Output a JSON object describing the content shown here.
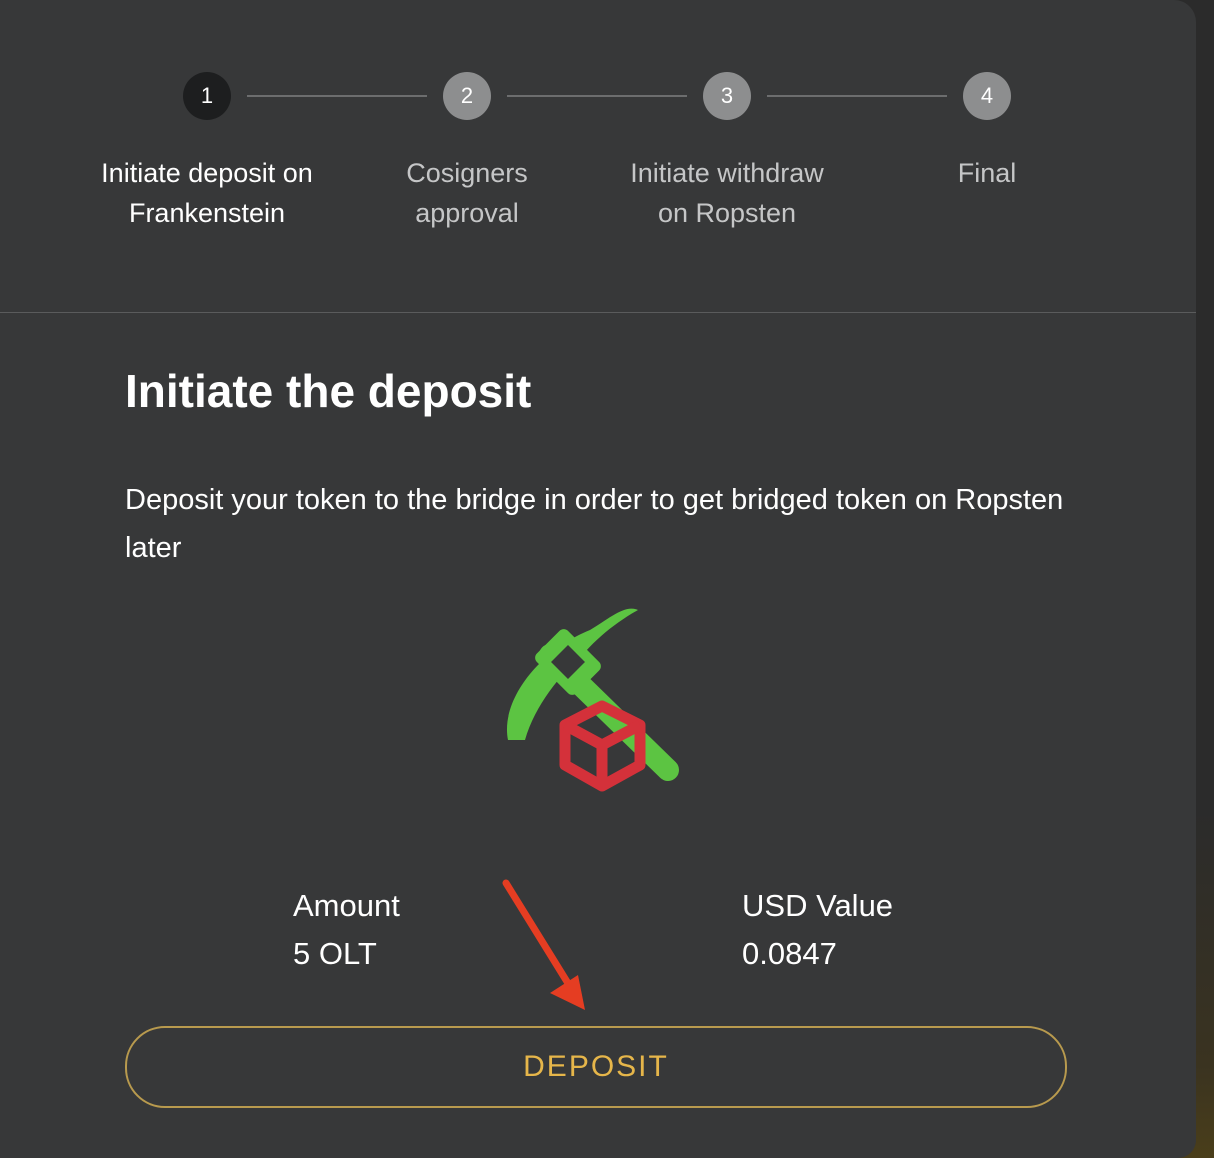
{
  "stepper": {
    "steps": [
      {
        "number": "1",
        "label_line1": "Initiate deposit on",
        "label_line2": "Frankenstein",
        "state": "active"
      },
      {
        "number": "2",
        "label_line1": "Cosigners",
        "label_line2": "approval",
        "state": "inactive"
      },
      {
        "number": "3",
        "label_line1": "Initiate withdraw",
        "label_line2": "on Ropsten",
        "state": "inactive"
      },
      {
        "number": "4",
        "label_line1": "Final",
        "label_line2": "",
        "state": "inactive"
      }
    ]
  },
  "content": {
    "heading": "Initiate the deposit",
    "description": "Deposit your token to the bridge in order to get bridged token on Ropsten later",
    "illustration": "pickaxe-block-icon",
    "amount_label": "Amount",
    "amount_value": "5 OLT",
    "usd_label": "USD Value",
    "usd_value": "0.0847",
    "deposit_button": "DEPOSIT"
  },
  "colors": {
    "panel": "#373839",
    "accent": "#e6b64a",
    "pickaxe": "#5cc442",
    "block": "#d4313a",
    "arrow": "#e53d22"
  }
}
